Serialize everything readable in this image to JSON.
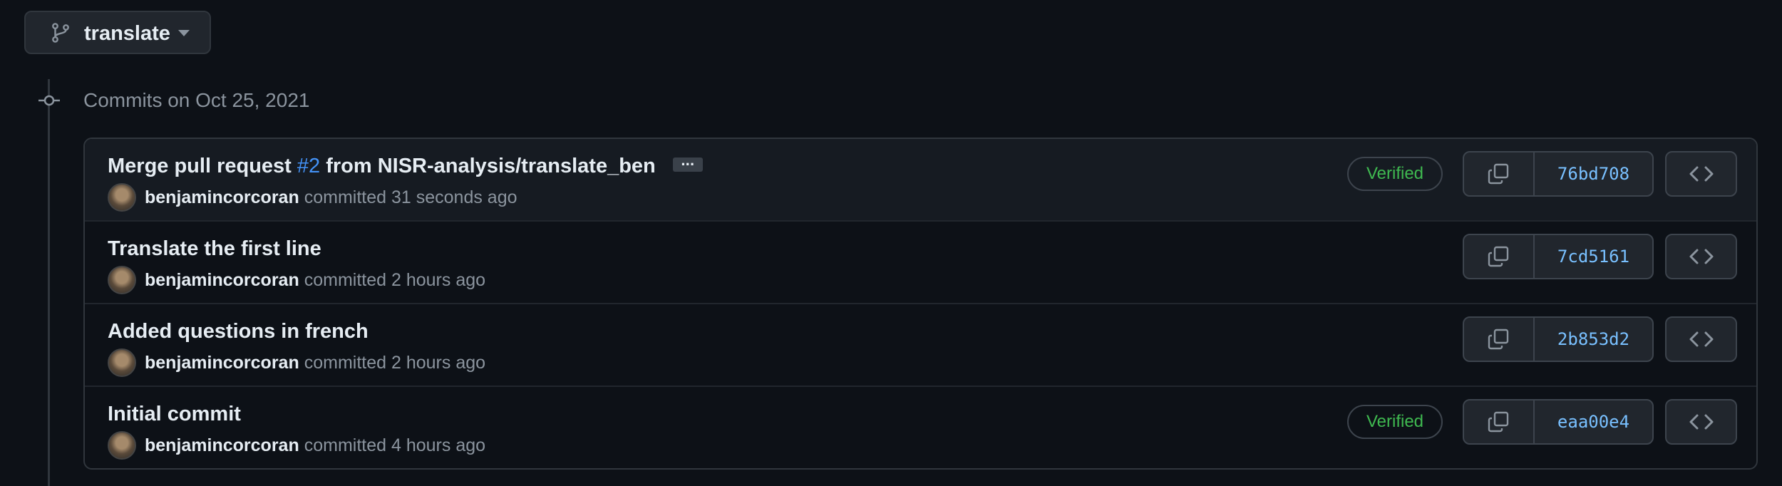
{
  "branch": {
    "name": "translate",
    "icon": "git-branch-icon"
  },
  "timeline": {
    "date_heading": "Commits on Oct 25, 2021",
    "icon": "git-commit-icon"
  },
  "commits": [
    {
      "title_prefix": "Merge pull request ",
      "pr_link": "#2",
      "title_suffix": " from NISR-analysis/translate_ben",
      "has_ellipsis": true,
      "ellipsis": "···",
      "author": "benjamincorcoran",
      "time": "committed 31 seconds ago",
      "verified": "Verified",
      "sha": "76bd708"
    },
    {
      "title_prefix": "Translate the first line",
      "author": "benjamincorcoran",
      "time": "committed 2 hours ago",
      "sha": "7cd5161"
    },
    {
      "title_prefix": "Added questions in french",
      "author": "benjamincorcoran",
      "time": "committed 2 hours ago",
      "sha": "2b853d2"
    },
    {
      "title_prefix": "Initial commit",
      "author": "benjamincorcoran",
      "time": "committed 4 hours ago",
      "verified": "Verified",
      "sha": "eaa00e4"
    }
  ],
  "colors": {
    "background": "#0d1117",
    "accent_link": "#4493f8",
    "verified": "#3fb950",
    "sha": "#79c0ff"
  }
}
